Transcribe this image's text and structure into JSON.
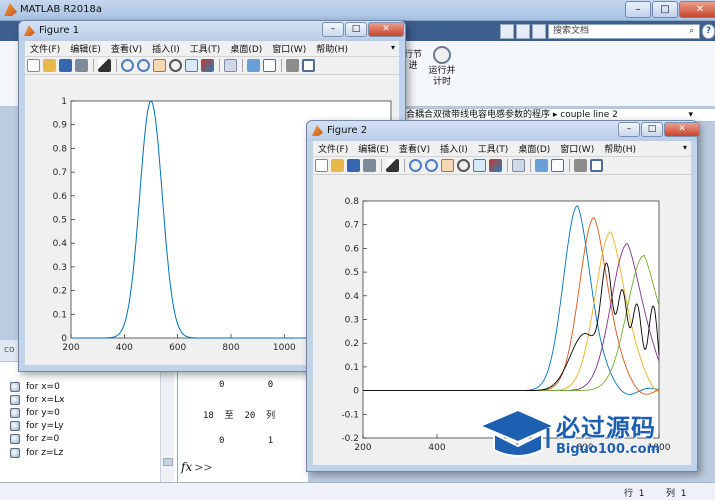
{
  "main_window": {
    "title": "MATLAB R2018a",
    "search_placeholder": "搜索文档",
    "ribbon_partial_label_1": "行节",
    "ribbon_partial_label_2": "进",
    "ribbon_run_time_label": "运行并\n计时",
    "address_path": "合耦合双微带线电容电感参数的程序 ▸ couple line 2",
    "left_header_partial": "co",
    "history_items": [
      "for x=0",
      "for x=Lx",
      "for y=0",
      "for y=Ly",
      "for z=0",
      "for z=Lz"
    ],
    "command_output": {
      "row1": "0        0        0",
      "columns_header": "18  至  20  列",
      "row2": "0        1        7"
    },
    "prompt_symbol": "fx",
    "prompt_chevrons": ">>",
    "status_row_label": "行",
    "status_row_value": "1",
    "status_col_label": "列",
    "status_col_value": "1"
  },
  "figure1": {
    "title": "Figure 1",
    "menu": [
      "文件(F)",
      "编辑(E)",
      "查看(V)",
      "插入(I)",
      "工具(T)",
      "桌面(D)",
      "窗口(W)",
      "帮助(H)"
    ]
  },
  "figure2": {
    "title": "Figure 2",
    "menu": [
      "文件(F)",
      "编辑(E)",
      "查看(V)",
      "插入(I)",
      "工具(T)",
      "桌面(D)",
      "窗口(W)",
      "帮助(H)"
    ]
  },
  "watermark": {
    "cn": "必过源码",
    "en": "Biguo100.com"
  },
  "colors": {
    "blue": "#0072BD",
    "orange": "#D95319",
    "yellow": "#EDB120",
    "purple": "#7E2F8E",
    "green": "#77AC30",
    "black": "#000000"
  },
  "chart_data": [
    {
      "type": "line",
      "title": "",
      "xlabel": "",
      "ylabel": "",
      "xlim": [
        200,
        1400
      ],
      "ylim": [
        0,
        1
      ],
      "xticks": [
        200,
        400,
        600,
        800,
        1000,
        1200
      ],
      "yticks": [
        0,
        0.1,
        0.2,
        0.3,
        0.4,
        0.5,
        0.6,
        0.7,
        0.8,
        0.9,
        1
      ],
      "series": [
        {
          "color": "#0072BD",
          "shape": "gaussian",
          "center": 500,
          "sigma": 42,
          "amplitude": 1.0
        }
      ]
    },
    {
      "type": "line",
      "title": "",
      "xlabel": "",
      "ylabel": "",
      "xlim": [
        200,
        1000
      ],
      "ylim": [
        -0.2,
        0.8
      ],
      "xticks": [
        200,
        400,
        600,
        800,
        1000
      ],
      "yticks": [
        -0.2,
        -0.1,
        0,
        0.1,
        0.2,
        0.3,
        0.4,
        0.5,
        0.6,
        0.7,
        0.8
      ],
      "series": [
        {
          "color": "#0072BD",
          "center": 780,
          "amplitude": 0.78,
          "width": 38
        },
        {
          "color": "#D95319",
          "center": 825,
          "amplitude": 0.73,
          "width": 40
        },
        {
          "color": "#EDB120",
          "center": 870,
          "amplitude": 0.67,
          "width": 42
        },
        {
          "color": "#7E2F8E",
          "center": 915,
          "amplitude": 0.62,
          "width": 44
        },
        {
          "color": "#77AC30",
          "center": 960,
          "amplitude": 0.57,
          "width": 46
        },
        {
          "color": "#000000",
          "center": 800,
          "amplitude": 0.24,
          "width": 40,
          "secondary": [
            [
              860,
              0.46
            ],
            [
              900,
              0.44
            ],
            [
              940,
              0.4
            ],
            [
              985,
              0.39
            ]
          ]
        }
      ]
    }
  ]
}
